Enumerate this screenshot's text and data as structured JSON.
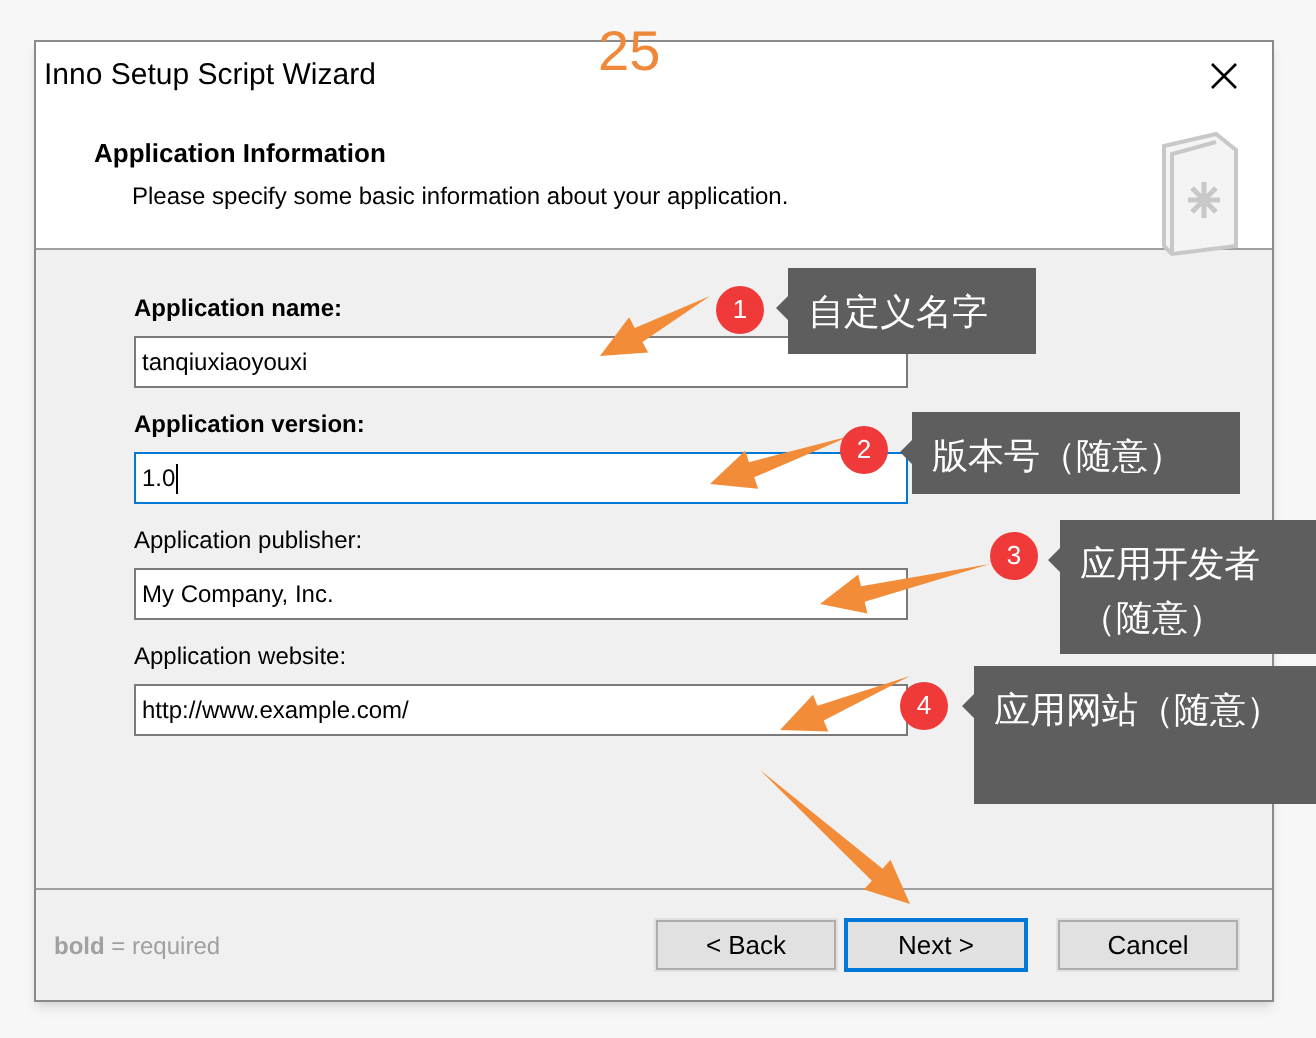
{
  "window": {
    "title": "Inno Setup Script Wizard"
  },
  "page_number": "25",
  "header": {
    "title": "Application Information",
    "subtitle": "Please specify some basic information about your application."
  },
  "fields": [
    {
      "label": "Application name:",
      "value": "tanqiuxiaoyouxi",
      "required": true,
      "focused": false
    },
    {
      "label": "Application version:",
      "value": "1.0",
      "required": true,
      "focused": true
    },
    {
      "label": "Application publisher:",
      "value": "My Company, Inc.",
      "required": false,
      "focused": false
    },
    {
      "label": "Application website:",
      "value": "http://www.example.com/",
      "required": false,
      "focused": false
    }
  ],
  "legend": {
    "bold": "bold",
    "rest": "= required"
  },
  "buttons": [
    {
      "label": "< Back",
      "default": false
    },
    {
      "label": "Next >",
      "default": true
    },
    {
      "label": "Cancel",
      "default": false
    }
  ],
  "callouts": [
    {
      "number": "1",
      "text": "自定义名字"
    },
    {
      "number": "2",
      "text": "版本号（随意）"
    },
    {
      "number": "3",
      "text": "应用开发者（随意）"
    },
    {
      "number": "4",
      "text": "应用网站（随意）"
    }
  ]
}
